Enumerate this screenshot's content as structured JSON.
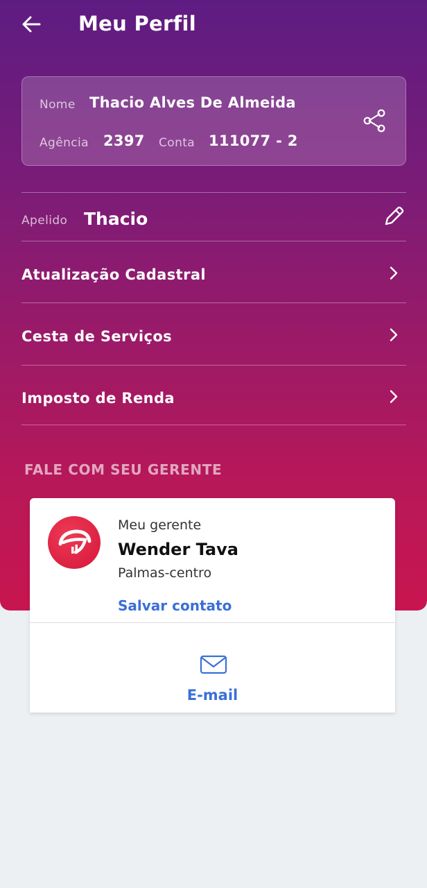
{
  "header": {
    "title": "Meu Perfil"
  },
  "profile": {
    "name_label": "Nome",
    "name_value": "Thacio Alves De Almeida",
    "agency_label": "Agência",
    "agency_value": "2397",
    "account_label": "Conta",
    "account_value": "111077 - 2"
  },
  "nickname": {
    "label": "Apelido",
    "value": "Thacio"
  },
  "menu": {
    "items": [
      {
        "label": "Atualização Cadastral"
      },
      {
        "label": "Cesta de Serviços"
      },
      {
        "label": "Imposto de Renda"
      }
    ]
  },
  "manager_section": {
    "title": "FALE COM SEU GERENTE",
    "role": "Meu gerente",
    "name": "Wender Tava",
    "branch": "Palmas-centro",
    "save_contact": "Salvar contato",
    "email_label": "E-mail"
  },
  "colors": {
    "gradient_top": "#5e1c82",
    "gradient_bottom": "#c8154f",
    "link_blue": "#3a6fd8",
    "logo_red": "#d4163a"
  },
  "icons": {
    "back": "arrow-left-icon",
    "share": "share-icon",
    "edit": "pencil-icon",
    "chevron": "chevron-right-icon",
    "email": "envelope-icon",
    "bank_logo": "bank-logo"
  }
}
